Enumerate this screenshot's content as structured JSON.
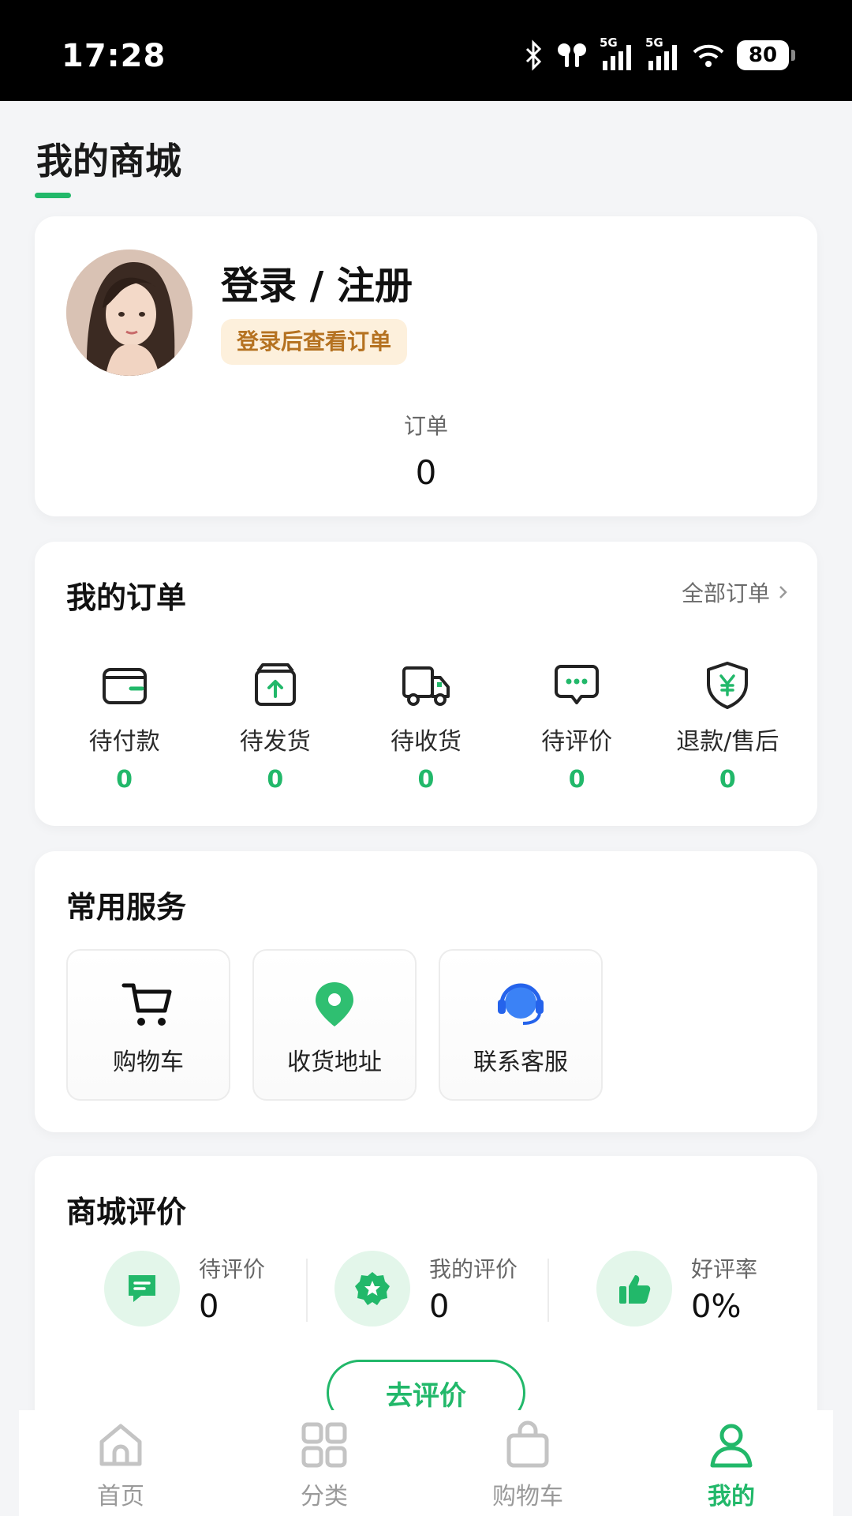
{
  "status_bar": {
    "time": "17:28",
    "network_1": "5G",
    "network_2": "5G",
    "battery": "80"
  },
  "page": {
    "title": "我的商城"
  },
  "profile": {
    "login_title": "登录 / 注册",
    "login_hint": "登录后查看订单",
    "orders_label": "订单",
    "orders_value": "0"
  },
  "orders": {
    "title": "我的订单",
    "view_all": "全部订单",
    "items": [
      {
        "label": "待付款",
        "count": "0",
        "icon": "wallet-icon"
      },
      {
        "label": "待发货",
        "count": "0",
        "icon": "package-upload-icon"
      },
      {
        "label": "待收货",
        "count": "0",
        "icon": "delivery-truck-icon"
      },
      {
        "label": "待评价",
        "count": "0",
        "icon": "chat-bubble-icon"
      },
      {
        "label": "退款/售后",
        "count": "0",
        "icon": "yen-shield-icon"
      }
    ]
  },
  "services": {
    "title": "常用服务",
    "items": [
      {
        "label": "购物车",
        "icon": "cart-icon"
      },
      {
        "label": "收货地址",
        "icon": "location-pin-icon"
      },
      {
        "label": "联系客服",
        "icon": "headset-icon"
      }
    ]
  },
  "reviews": {
    "title": "商城评价",
    "stats": [
      {
        "label": "待评价",
        "value": "0",
        "icon": "message-icon"
      },
      {
        "label": "我的评价",
        "value": "0",
        "icon": "star-badge-icon"
      },
      {
        "label": "好评率",
        "value": "0%",
        "icon": "thumbs-up-icon"
      }
    ],
    "button": "去评价"
  },
  "tabbar": {
    "items": [
      {
        "label": "首页",
        "icon": "home-icon"
      },
      {
        "label": "分类",
        "icon": "grid-icon"
      },
      {
        "label": "购物车",
        "icon": "shopping-bag-icon"
      },
      {
        "label": "我的",
        "icon": "user-icon",
        "active": true
      }
    ]
  },
  "colors": {
    "accent": "#22b86a",
    "badge_bg": "#fdf0dc",
    "badge_text": "#b57221",
    "blue": "#3b82f6"
  }
}
